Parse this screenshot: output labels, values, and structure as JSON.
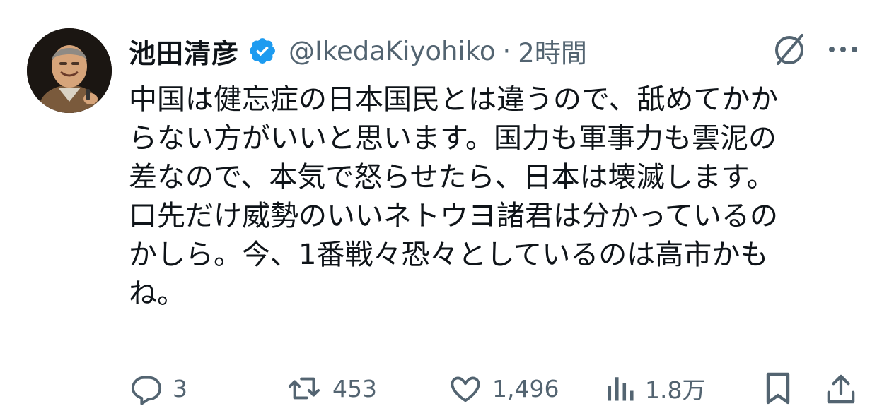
{
  "author": {
    "display_name": "池田清彦",
    "handle": "@IkedaKiyohiko",
    "separator": "·",
    "time": "2時間",
    "verified": true
  },
  "tweet": {
    "lines": [
      "中国は健忘症の日本国民とは違うので、舐めてかか",
      "らない方がいいと思います。国力も軍事力も雲泥の",
      "差なので、本気で怒らせたら、日本は壊滅します。",
      "口先だけ威勢のいいネトウヨ諸君は分かっているの",
      "かしら。今、1番戦々恐々としているのは高市かも",
      "ね。"
    ]
  },
  "metrics": {
    "replies": "3",
    "reposts": "453",
    "likes": "1,496",
    "views": "1.8万"
  },
  "icons": {
    "verified": "verified-badge-icon",
    "grok": "grok-icon",
    "more": "more-icon",
    "reply": "reply-icon",
    "repost": "repost-icon",
    "like": "like-icon",
    "views": "views-icon",
    "bookmark": "bookmark-icon",
    "share": "share-icon"
  },
  "colors": {
    "text": "#0f1419",
    "secondary": "#536471",
    "verified": "#1d9bf0"
  }
}
